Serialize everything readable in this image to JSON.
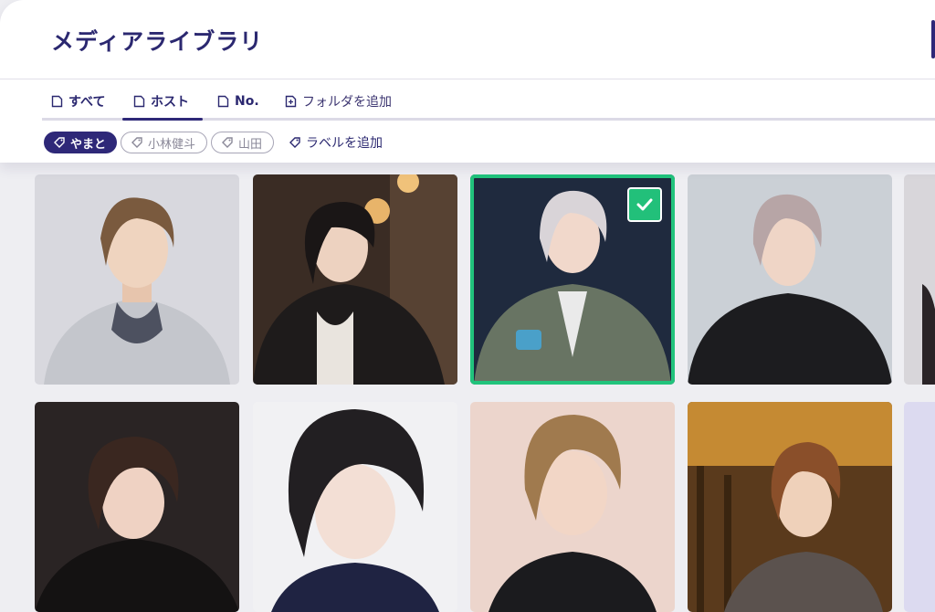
{
  "header": {
    "title": "メディアライブラリ"
  },
  "tabs": [
    {
      "label": "すべて",
      "icon": "document-icon",
      "active": false
    },
    {
      "label": "ホスト",
      "icon": "document-icon",
      "active": true
    },
    {
      "label": "No.",
      "icon": "document-icon",
      "active": false
    },
    {
      "label": "フォルダを追加",
      "icon": "add-folder-icon",
      "active": false
    }
  ],
  "labels": {
    "chips": [
      {
        "label": "やまと",
        "selected": true
      },
      {
        "label": "小林健斗",
        "selected": false
      },
      {
        "label": "山田",
        "selected": false
      }
    ],
    "add_label": "ラベルを追加"
  },
  "gallery": {
    "selected_index": 2,
    "accent_color": "#21c37c",
    "items": [
      {
        "name": "host-photo-1"
      },
      {
        "name": "host-photo-2"
      },
      {
        "name": "host-photo-3"
      },
      {
        "name": "host-photo-4"
      },
      {
        "name": "host-photo-5"
      },
      {
        "name": "host-photo-6"
      },
      {
        "name": "host-photo-7"
      },
      {
        "name": "host-photo-8"
      },
      {
        "name": "host-photo-9"
      },
      {
        "name": "host-photo-10"
      }
    ]
  },
  "colors": {
    "brand": "#2e2878",
    "selected": "#21c37c"
  }
}
